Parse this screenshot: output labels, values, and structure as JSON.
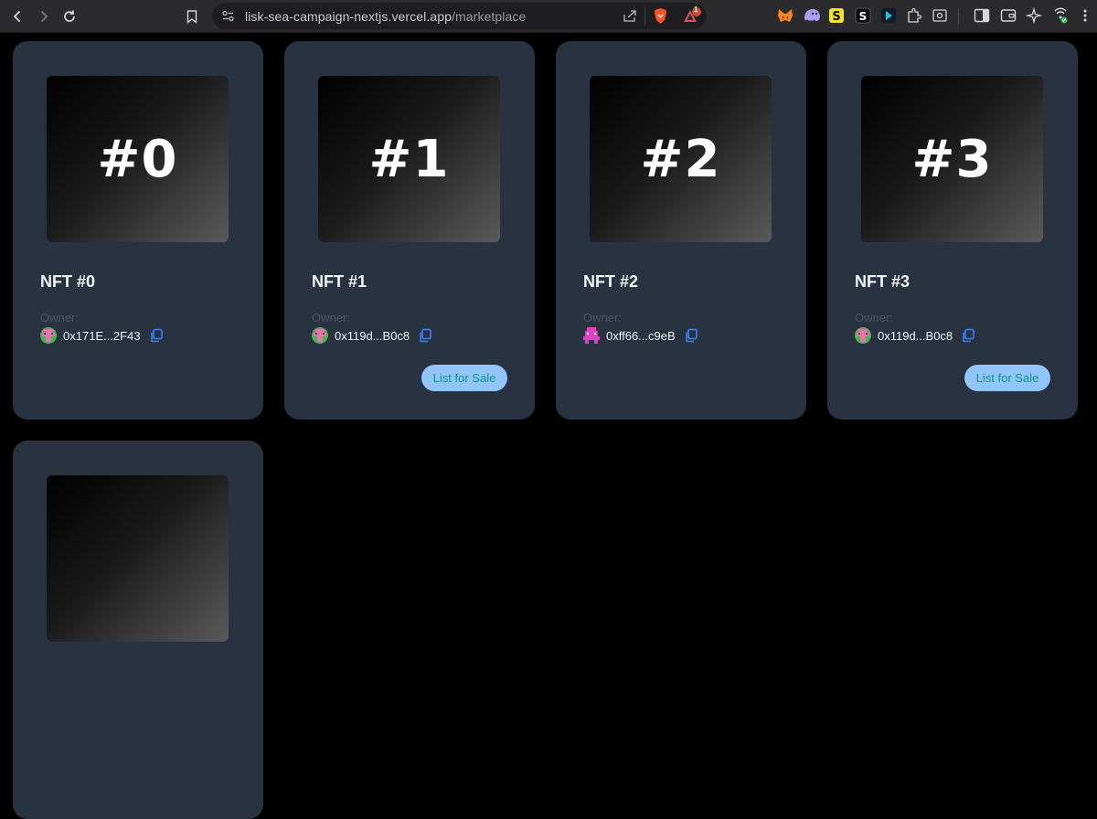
{
  "browser": {
    "url_host": "lisk-sea-campaign-nextjs.vercel.app",
    "url_path": "/marketplace",
    "notification_count": "1"
  },
  "colors": {
    "page_bg": "#000000",
    "card_bg": "#283241",
    "button_bg": "#93c5fd",
    "button_text": "#0d9488",
    "copy_icon": "#3b82f6"
  },
  "marketplace": {
    "owner_label": "Owner:",
    "list_button_label": "List for Sale",
    "cards": [
      {
        "art_label": "#0",
        "title": "NFT #0",
        "owner": "0x171E...2F43",
        "avatar": "green-pink-avatar",
        "listable": false
      },
      {
        "art_label": "#1",
        "title": "NFT #1",
        "owner": "0x119d...B0c8",
        "avatar": "green-pink-avatar",
        "listable": true
      },
      {
        "art_label": "#2",
        "title": "NFT #2",
        "owner": "0xff66...c9eB",
        "avatar": "magenta-avatar",
        "listable": false
      },
      {
        "art_label": "#3",
        "title": "NFT #3",
        "owner": "0x119d...B0c8",
        "avatar": "green-pink-avatar",
        "listable": true
      }
    ]
  }
}
